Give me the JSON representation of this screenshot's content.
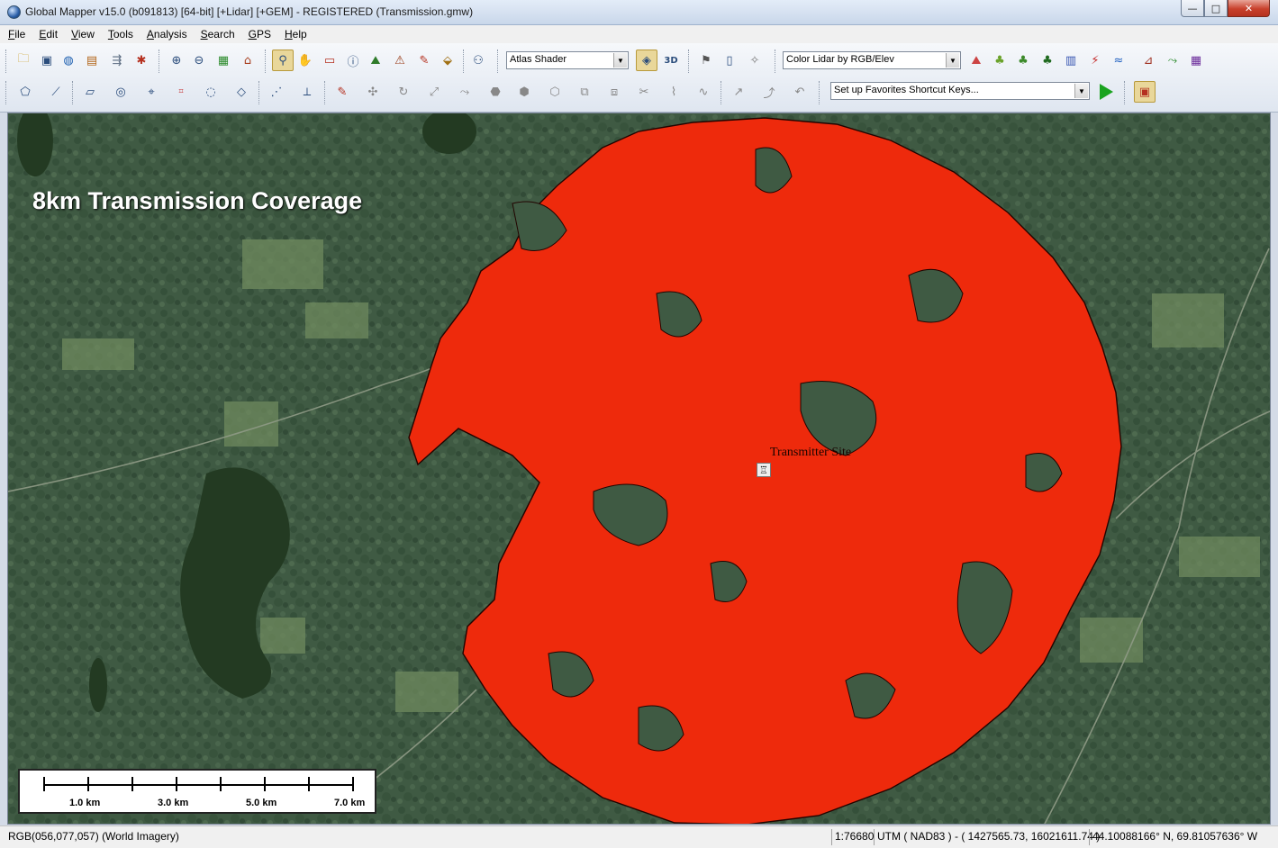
{
  "window": {
    "title": "Global Mapper v15.0 (b091813) [64-bit] [+Lidar] [+GEM] - REGISTERED (Transmission.gmw)",
    "min_symbol": "—",
    "max_symbol": "□",
    "close_symbol": "✕"
  },
  "menu": [
    {
      "u": "F",
      "rest": "ile"
    },
    {
      "u": "E",
      "rest": "dit"
    },
    {
      "u": "V",
      "rest": "iew"
    },
    {
      "u": "T",
      "rest": "ools"
    },
    {
      "u": "A",
      "rest": "nalysis"
    },
    {
      "u": "S",
      "rest": "earch"
    },
    {
      "u": "G",
      "rest": "PS"
    },
    {
      "u": "H",
      "rest": "elp"
    }
  ],
  "toolbar": {
    "shader_value": "Atlas Shader",
    "lidar_value": "Color Lidar by RGB/Elev",
    "favorites_value": "Set up Favorites Shortcut Keys...",
    "dropdown_arrow": "▼"
  },
  "map": {
    "overlay_title": "8km Transmission Coverage",
    "site_label": "Transmitter Site",
    "site_icon": "♖",
    "coverage_color": "#ee2a0c",
    "scale_labels": [
      "1.0 km",
      "3.0 km",
      "5.0 km",
      "7.0 km"
    ]
  },
  "status": {
    "pixel_info": "RGB(056,077,057) (World Imagery)",
    "scale": "1:76680",
    "projection": "UTM ( NAD83 ) - ( 1427565.73, 16021611.74 )",
    "latlon": "44.10088166° N, 69.81057636° W"
  }
}
